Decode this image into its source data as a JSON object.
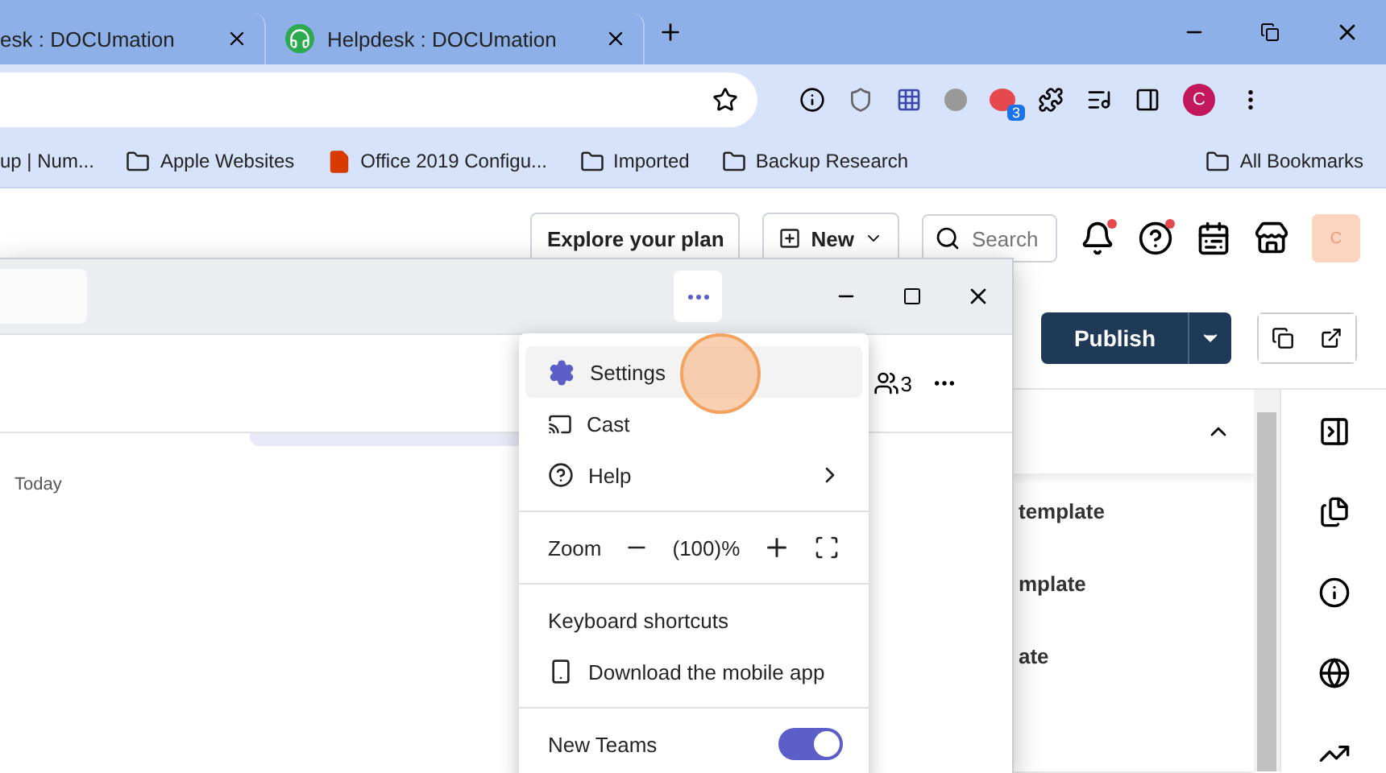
{
  "browser": {
    "tabs": [
      {
        "title": "esk : DOCUmation",
        "selected": false
      },
      {
        "title": "Helpdesk : DOCUmation",
        "selected": false
      }
    ],
    "extension_badge": "3",
    "profile": "C",
    "bookmarks": [
      {
        "label": "up | Num...",
        "kind": "page"
      },
      {
        "label": "Apple Websites",
        "kind": "folder"
      },
      {
        "label": "Office 2019 Configu...",
        "kind": "office"
      },
      {
        "label": "Imported",
        "kind": "folder"
      },
      {
        "label": "Backup Research",
        "kind": "folder"
      }
    ],
    "all_bookmarks": "All Bookmarks"
  },
  "page": {
    "explore": "Explore your plan",
    "new": "New",
    "search": {
      "placeholder": "Search"
    },
    "notifications_unread": true,
    "help_unread": true,
    "avatar": "C",
    "publish": "Publish",
    "panel": {
      "expanded": true,
      "items": [
        "template",
        "mplate",
        "ate"
      ]
    }
  },
  "teams": {
    "people_count": "3",
    "day": "Today",
    "menu": [
      {
        "kind": "settings",
        "label": "Settings",
        "selected": true
      },
      {
        "kind": "cast",
        "label": "Cast",
        "selected": false
      },
      {
        "kind": "help",
        "label": "Help",
        "selected": false
      },
      {
        "kind": "zoom",
        "label": "Zoom",
        "value": "(100)%",
        "selected": false
      },
      {
        "kind": "plain",
        "label": "Keyboard shortcuts",
        "selected": false
      },
      {
        "kind": "download",
        "label": "Download the mobile app",
        "selected": false
      },
      {
        "kind": "toggle",
        "label": "New Teams",
        "on": true,
        "selected": false
      }
    ]
  }
}
